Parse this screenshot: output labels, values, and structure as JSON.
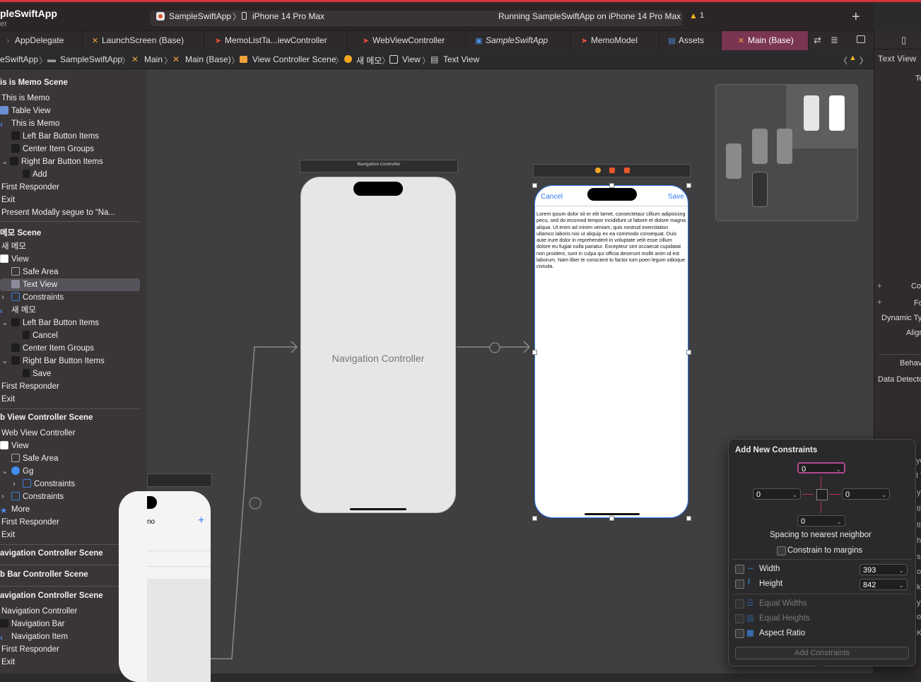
{
  "toolbar": {
    "app_title": "pleSwiftApp",
    "app_subtitle": "er",
    "scheme_target": "SampleSwiftApp",
    "scheme_device": "iPhone 14 Pro Max",
    "status": "Running SampleSwiftApp on iPhone 14 Pro Max",
    "warning_count": "1",
    "add_label": "+"
  },
  "tabs": [
    {
      "label": "AppDelegate",
      "icon": "swift-file-icon"
    },
    {
      "label": "LaunchScreen (Base)",
      "icon": "storyboard-icon"
    },
    {
      "label": "MemoListTa...iewController",
      "icon": "swift-file-icon"
    },
    {
      "label": "WebViewController",
      "icon": "swift-file-icon"
    },
    {
      "label": "SampleSwiftApp",
      "icon": "app-icon"
    },
    {
      "label": "MemoModel",
      "icon": "swift-file-icon"
    },
    {
      "label": "Assets",
      "icon": "assets-icon"
    },
    {
      "label": "Main (Base)",
      "icon": "storyboard-icon"
    }
  ],
  "breadcrumb": [
    "eSwiftApp",
    "SampleSwiftApp",
    "Main",
    "Main (Base)",
    "View Controller Scene",
    "새 메모",
    "View",
    "Text View"
  ],
  "outline": {
    "memo_scene": "is is Memo Scene",
    "memo_rows": [
      "This is Memo",
      "Table View",
      "This is Memo",
      "Left Bar Button Items",
      "Center Item Groups",
      "Right Bar Button Items",
      "Add",
      "First Responder",
      "Exit",
      "Present Modally segue to “Na..."
    ],
    "new_memo_scene": "메모 Scene",
    "new_memo_rows": [
      "새 메모",
      "View",
      "Safe Area",
      "Text View",
      "Constraints",
      "새 메모",
      "Left Bar Button Items",
      "Cancel",
      "Center Item Groups",
      "Right Bar Button Items",
      "Save",
      "First Responder",
      "Exit"
    ],
    "web_scene": "b View Controller Scene",
    "web_rows": [
      "Web View Controller",
      "View",
      "Safe Area",
      "Gg",
      "Constraints",
      "Constraints",
      "More",
      "First Responder",
      "Exit"
    ],
    "nav_scene_1": "avigation Controller Scene",
    "tab_scene": "b Bar Controller Scene",
    "nav_scene_2": "avigation Controller Scene",
    "nav_rows": [
      "Navigation Controller",
      "Navigation Bar",
      "Navigation Item",
      "First Responder",
      "Exit"
    ]
  },
  "canvas": {
    "nav_scene_bar": "Navigation Controller",
    "nav_controller_label": "Navigation Controller",
    "memo_cancel": "Cancel",
    "memo_save": "Save",
    "lorem": "Lorem ipsum dolor sit er elit lamet, consectetaur cillium adipisicing pecu, sed do eiusmod tempor incididunt ut labore et dolore magna aliqua. Ut enim ad minim veniam, quis nostrud exercitation ullamco laboris nisi ut aliquip ex ea commodo consequat. Duis aute irure dolor in reprehenderit in voluptate velit esse cillum dolore eu fugiat nulla pariatur. Excepteur sint occaecat cupidatat non proident, sunt in culpa qui officia deserunt mollit anim id est laborum. Nam liber te conscient to factor tum poen legum odioque civiuda.",
    "partial_title": "no",
    "partial_add": "+"
  },
  "inspector": {
    "title": "Text View",
    "t1": "Te",
    "co": "Co",
    "fo": "Fo",
    "dynamic": "Dynamic Ty",
    "align": "Alignme",
    "behav": "Behav",
    "detect": "Data Detecto",
    "cut_letters": [
      "yo",
      "t T",
      "y",
      "ti",
      "ti",
      "h",
      "s",
      "ot",
      "ki",
      "y",
      "o",
      "K"
    ]
  },
  "constraints": {
    "title": "Add New Constraints",
    "top": "0",
    "left": "0",
    "right": "0",
    "bottom": "0",
    "spacing_label": "Spacing to nearest neighbor",
    "constrain_margins": "Constrain to margins",
    "width_label": "Width",
    "width_value": "393",
    "height_label": "Height",
    "height_value": "842",
    "equal_widths": "Equal Widths",
    "equal_heights": "Equal Heights",
    "aspect_ratio": "Aspect Ratio",
    "add_button": "Add Constraints"
  },
  "colors": {
    "accent": "#7a3553",
    "ios_blue": "#2f7cf6",
    "warning": "#f5b71f"
  }
}
